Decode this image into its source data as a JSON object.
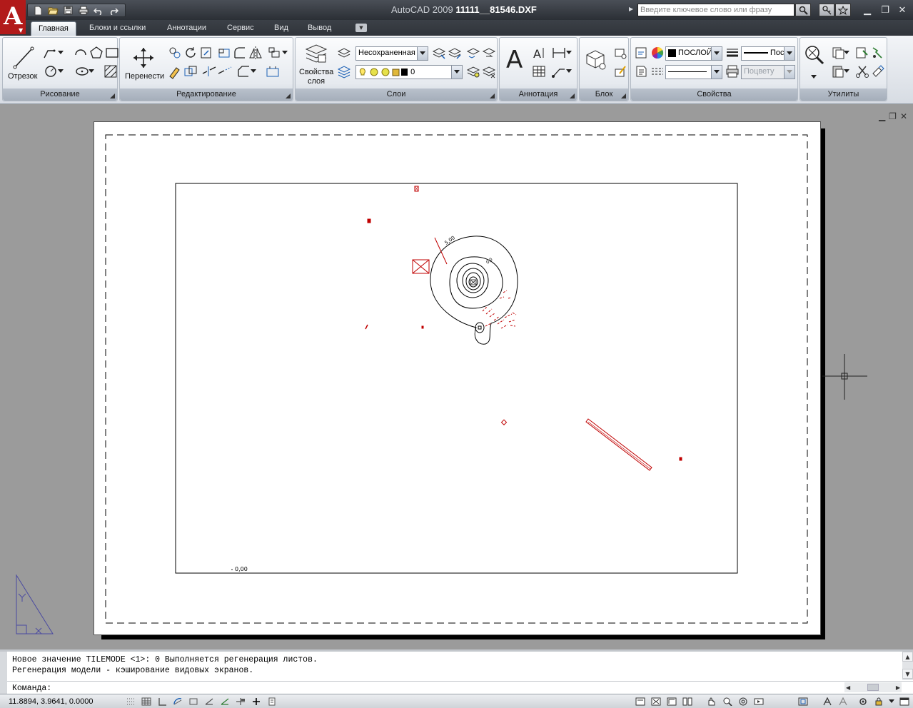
{
  "title": {
    "app_name": "AutoCAD 2009",
    "file_name": "11111__81546.DXF"
  },
  "search": {
    "placeholder": "Введите ключевое слово или фразу"
  },
  "ribbon_tabs": [
    "Главная",
    "Блоки и ссылки",
    "Аннотации",
    "Сервис",
    "Вид",
    "Вывод"
  ],
  "active_tab": "Главная",
  "panels": {
    "draw": {
      "title": "Рисование",
      "line_label": "Отрезок"
    },
    "modify": {
      "title": "Редактирование",
      "move_label": "Перенести"
    },
    "layers": {
      "title": "Слои",
      "props_label_1": "Свойства",
      "props_label_2": "слоя",
      "state_value": "Несохраненная",
      "layer_value": "0"
    },
    "annotation": {
      "title": "Аннотация"
    },
    "block": {
      "title": "Блок"
    },
    "properties": {
      "title": "Свойства",
      "color_value": "ПОСЛОЙ",
      "lineweight_value": "Пос",
      "plotstyle_value": "Поцвету"
    },
    "utilities": {
      "title": "Утилиты"
    }
  },
  "drawing": {
    "elevation_label": "0,00",
    "contour_label_1": "5,00",
    "contour_label_2": "0,0",
    "entity_color": "#c00000"
  },
  "command": {
    "history": [
      "Новое значение TILEMODE <1>: 0 Выполняется регенерация листов.",
      "Регенерация модели - кэширование видовых экранов."
    ],
    "prompt": "Команда:"
  },
  "status": {
    "coordinates": "11.8894, 3.9641, 0.0000"
  },
  "colors": {
    "title_bar": "#2b2f35",
    "app_logo": "#b21a1a",
    "workspace": "#9b9b9b"
  }
}
